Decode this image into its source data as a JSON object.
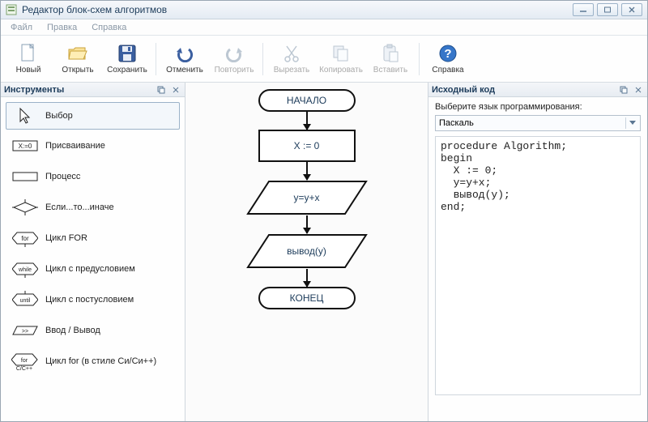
{
  "window": {
    "title": "Редактор блок-схем алгоритмов"
  },
  "menu": {
    "file": "Файл",
    "edit": "Правка",
    "help": "Справка"
  },
  "toolbar": {
    "new": "Новый",
    "open": "Открыть",
    "save": "Сохранить",
    "undo": "Отменить",
    "redo": "Повторить",
    "cut": "Вырезать",
    "copy": "Копировать",
    "paste": "Вставить",
    "help": "Справка"
  },
  "leftPanel": {
    "title": "Инструменты",
    "items": {
      "select": "Выбор",
      "assign": "Присваивание",
      "process": "Процесс",
      "if": "Если...то...иначе",
      "for": "Цикл FOR",
      "while": "Цикл с предусловием",
      "until": "Цикл с постусловием",
      "io": "Ввод / Вывод",
      "forc": "Цикл for (в стиле Си/Си++)"
    }
  },
  "flowchart": {
    "start": "НАЧАЛО",
    "assign": "X := 0",
    "expr": "y=y+x",
    "output": "вывод(y)",
    "end": "КОНЕЦ"
  },
  "rightPanel": {
    "title": "Исходный код",
    "langLabel": "Выберите язык программирования:",
    "language": "Паскаль",
    "code": "procedure Algorithm;\nbegin\n  X := 0;\n  y=y+x;\n  вывод(y);\nend;"
  }
}
